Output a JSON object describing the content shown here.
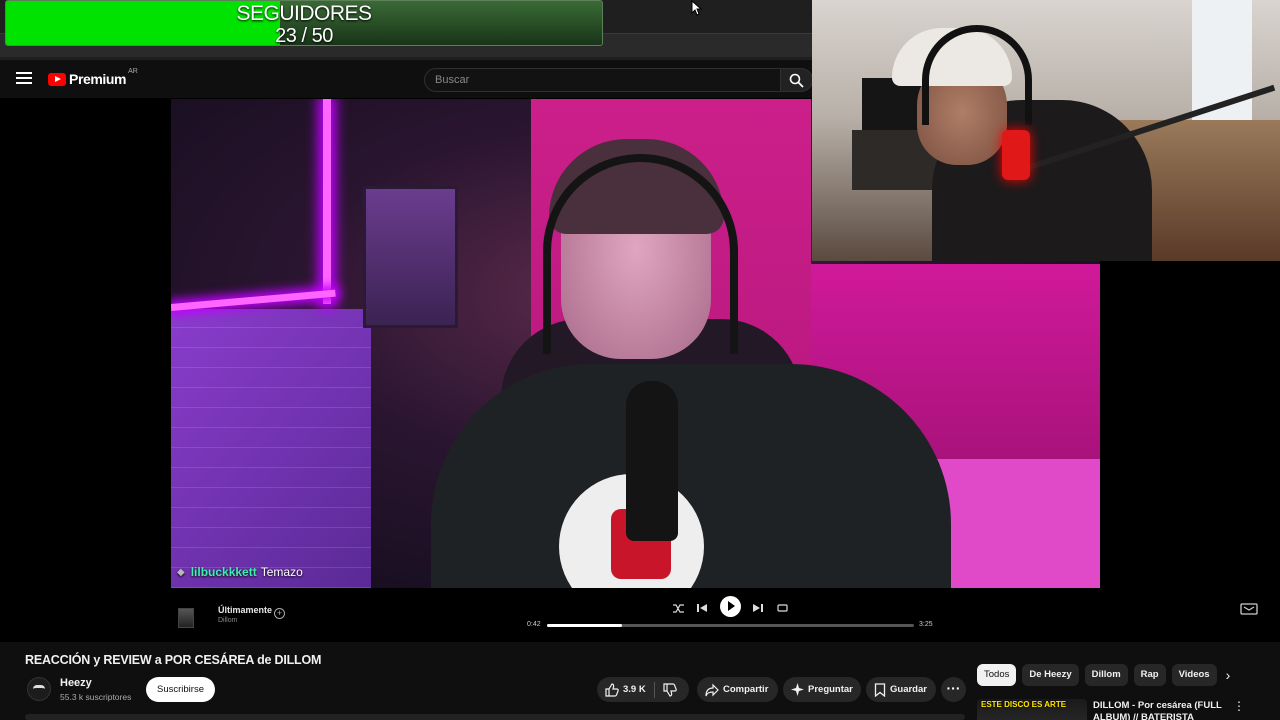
{
  "overlay": {
    "goal_label": "SEGUIDORES",
    "goal_count": "23 / 50",
    "goal_fraction": 0.46,
    "fill_color": "#00e300"
  },
  "header": {
    "logo_text": "Premium",
    "country_code": "AR",
    "search_placeholder": "Buscar"
  },
  "chat": {
    "user": "lilbuckkkett",
    "message": "Temazo"
  },
  "player": {
    "song_title": "Últimamente",
    "song_artist": "Dillom",
    "current_time": "0:42",
    "duration": "3:25",
    "progress_fraction": 0.205
  },
  "video_info": {
    "title": "REACCIÓN y REVIEW a POR CESÁREA de DILLOM",
    "channel_name": "Heezy",
    "subscribers": "55.3 k suscriptores",
    "subscribe_label": "Suscribirse",
    "like_count": "3.9 K",
    "share_label": "Compartir",
    "ask_label": "Preguntar",
    "save_label": "Guardar"
  },
  "chips": [
    "Todos",
    "De Heezy",
    "Dillom",
    "Rap",
    "Videos"
  ],
  "recommendation": {
    "thumb_text": "ESTE DISCO ES ARTE",
    "title": "DILLOM - Por cesárea (FULL ALBUM) // BATERISTA"
  },
  "colors": {
    "youtube_red": "#ff0000",
    "chat_user": "#3cf0b0",
    "background": "#0f0f0f"
  }
}
